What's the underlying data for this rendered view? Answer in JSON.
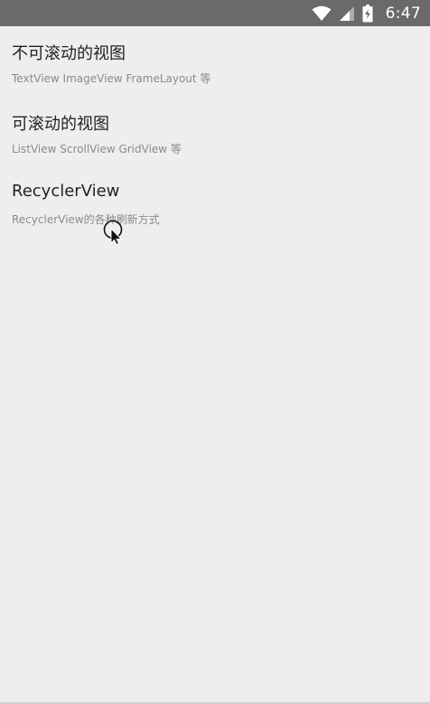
{
  "status_bar": {
    "time": "6:47",
    "icons": [
      "wifi-icon",
      "signal-icon",
      "battery-charging-icon"
    ]
  },
  "list": {
    "items": [
      {
        "title": "不可滚动的视图",
        "subtitle": "TextView ImageView FrameLayout 等"
      },
      {
        "title": "可滚动的视图",
        "subtitle": "ListView ScrollView GridView 等"
      },
      {
        "title": "RecyclerView",
        "subtitle": "RecyclerView的各种刷新方式"
      }
    ]
  },
  "colors": {
    "status_bar": "#6a6a6a",
    "background": "#eeeeee",
    "title": "#222222",
    "subtitle": "#8a8a8a"
  }
}
